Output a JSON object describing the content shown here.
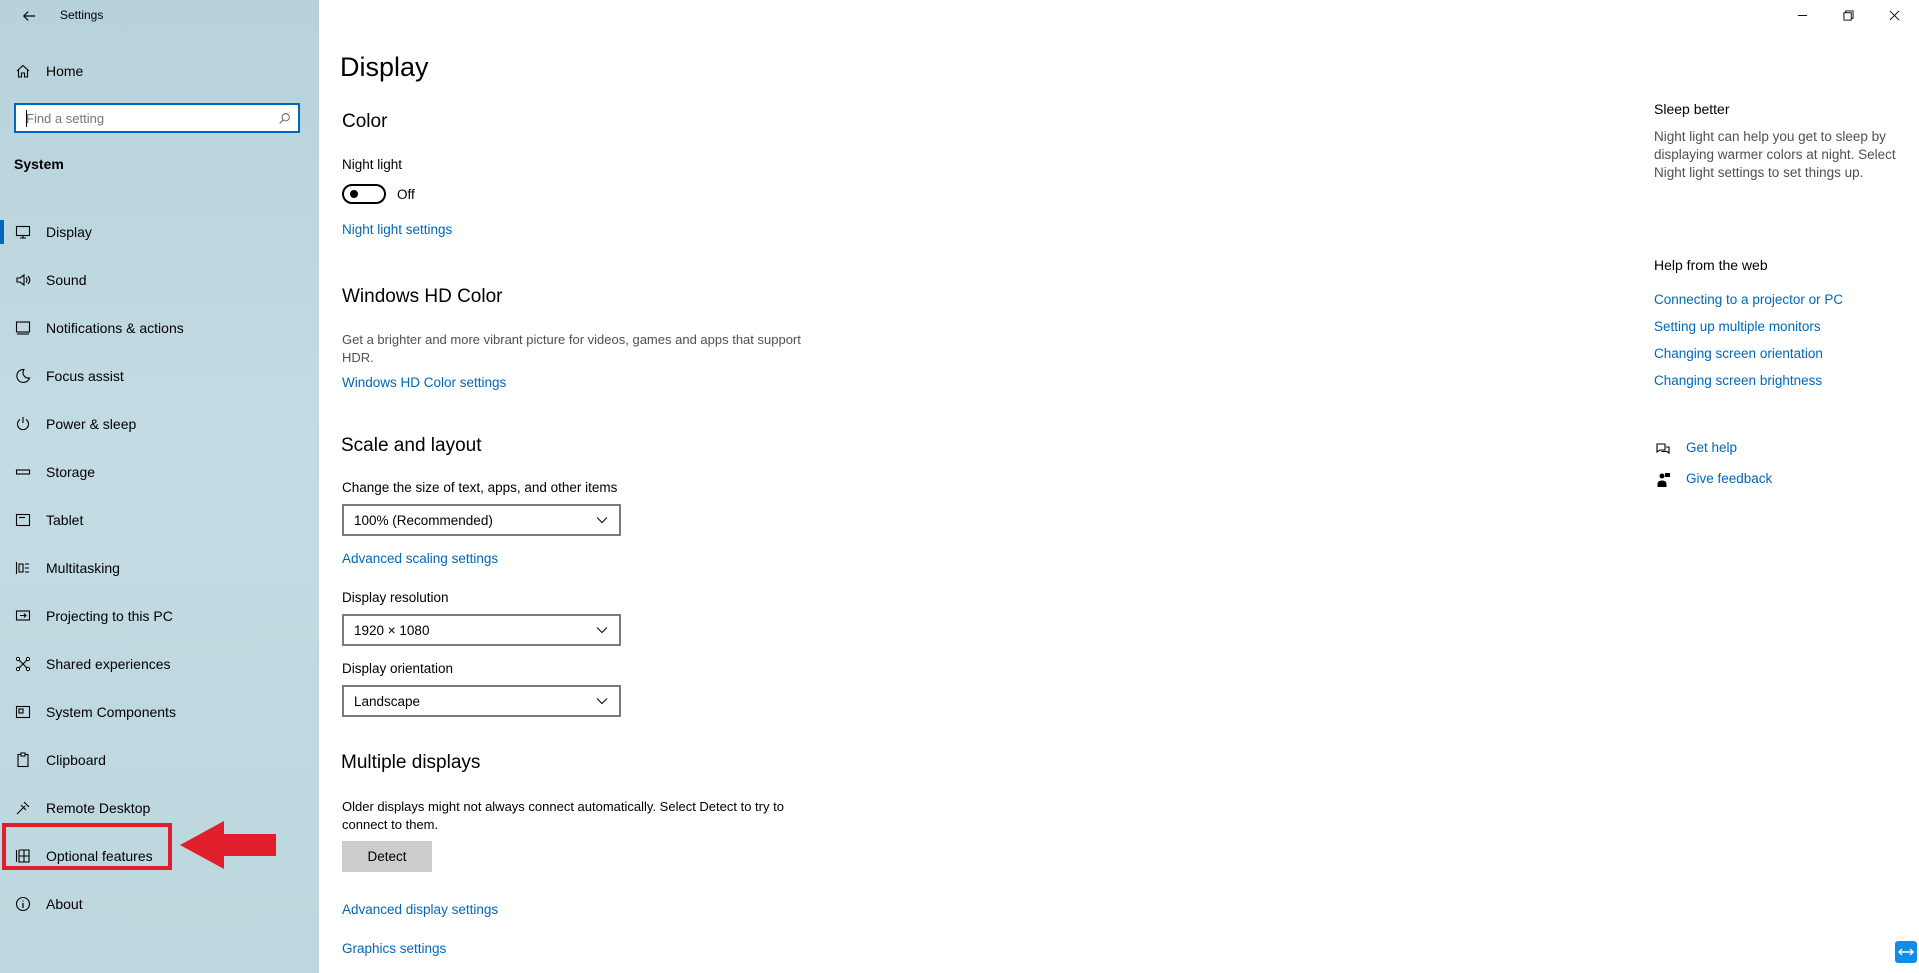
{
  "window": {
    "title": "Settings",
    "back_icon": "back-arrow-icon",
    "controls": [
      "minimize-icon",
      "restore-icon",
      "close-icon"
    ]
  },
  "sidebar": {
    "home_label": "Home",
    "search": {
      "value": "",
      "placeholder": "Find a setting"
    },
    "section_label": "System",
    "items": [
      {
        "label": "Display",
        "icon": "display-icon",
        "selected": true
      },
      {
        "label": "Sound",
        "icon": "sound-icon"
      },
      {
        "label": "Notifications & actions",
        "icon": "notifications-icon"
      },
      {
        "label": "Focus assist",
        "icon": "moon-icon"
      },
      {
        "label": "Power & sleep",
        "icon": "power-icon"
      },
      {
        "label": "Storage",
        "icon": "storage-icon"
      },
      {
        "label": "Tablet",
        "icon": "tablet-icon"
      },
      {
        "label": "Multitasking",
        "icon": "multitasking-icon"
      },
      {
        "label": "Projecting to this PC",
        "icon": "projecting-icon"
      },
      {
        "label": "Shared experiences",
        "icon": "shared-icon"
      },
      {
        "label": "System Components",
        "icon": "components-icon"
      },
      {
        "label": "Clipboard",
        "icon": "clipboard-icon"
      },
      {
        "label": "Remote Desktop",
        "icon": "remote-icon"
      },
      {
        "label": "Optional features",
        "icon": "optional-features-icon",
        "highlighted": true
      },
      {
        "label": "About",
        "icon": "info-icon"
      }
    ]
  },
  "annotation": {
    "color": "#e11e2b"
  },
  "main": {
    "title": "Display",
    "color": {
      "heading": "Color",
      "night_light_label": "Night light",
      "night_light_state": "Off",
      "night_light_link": "Night light settings"
    },
    "hd_color": {
      "heading": "Windows HD Color",
      "description": "Get a brighter and more vibrant picture for videos, games and apps that support HDR.",
      "link": "Windows HD Color settings"
    },
    "scale": {
      "heading": "Scale and layout",
      "size_label": "Change the size of text, apps, and other items",
      "size_value": "100% (Recommended)",
      "advanced_link": "Advanced scaling settings",
      "resolution_label": "Display resolution",
      "resolution_value": "1920 × 1080",
      "orientation_label": "Display orientation",
      "orientation_value": "Landscape"
    },
    "multiple": {
      "heading": "Multiple displays",
      "description": "Older displays might not always connect automatically. Select Detect to try to connect to them.",
      "detect_label": "Detect",
      "advanced_link": "Advanced display settings",
      "graphics_link": "Graphics settings"
    }
  },
  "right_panel": {
    "sleep_heading": "Sleep better",
    "sleep_text": "Night light can help you get to sleep by displaying warmer colors at night. Select Night light settings to set things up.",
    "help_heading": "Help from the web",
    "help_links": [
      "Connecting to a projector or PC",
      "Setting up multiple monitors",
      "Changing screen orientation",
      "Changing screen brightness"
    ],
    "get_help": "Get help",
    "give_feedback": "Give feedback"
  },
  "colors": {
    "accent": "#0067b8",
    "sidebar": "#bdd7de"
  }
}
